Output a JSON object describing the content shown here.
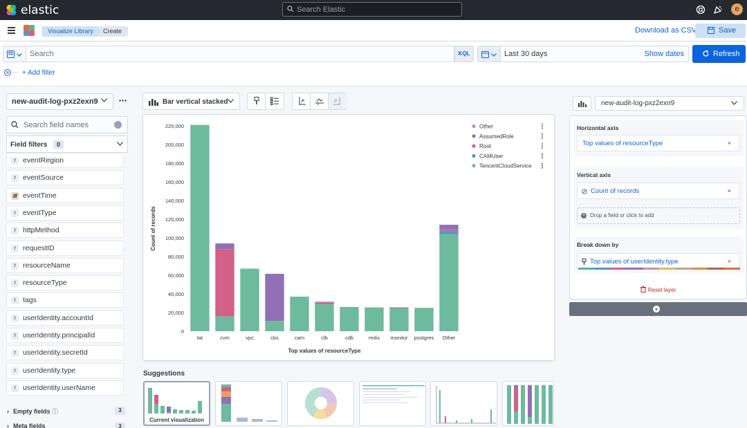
{
  "header": {
    "brand": "elastic",
    "search_placeholder": "Search Elastic",
    "avatar_initial": "e"
  },
  "subbar": {
    "breadcrumbs": [
      "Visualize Library",
      "Create"
    ],
    "download_label": "Download as CSV",
    "save_label": "Save"
  },
  "query": {
    "placeholder": "Search",
    "language": "KQL",
    "date_range": "Last 30 days",
    "show_dates_label": "Show dates",
    "refresh_label": "Refresh",
    "add_filter_label": "+ Add filter"
  },
  "left": {
    "index_pattern": "new-audit-log-pxz2exn9",
    "field_search_placeholder": "Search field names",
    "field_filters_label": "Field filters",
    "field_filters_count": "0",
    "fields": [
      {
        "name": "eventRegion",
        "type": "t"
      },
      {
        "name": "eventSource",
        "type": "t"
      },
      {
        "name": "eventTime",
        "type": "date"
      },
      {
        "name": "eventType",
        "type": "t"
      },
      {
        "name": "httpMethod",
        "type": "t"
      },
      {
        "name": "requestID",
        "type": "t"
      },
      {
        "name": "resourceName",
        "type": "t"
      },
      {
        "name": "resourceType",
        "type": "t"
      },
      {
        "name": "tags",
        "type": "t"
      },
      {
        "name": "userIdentity.accountId",
        "type": "t"
      },
      {
        "name": "userIdentity.principalId",
        "type": "t"
      },
      {
        "name": "userIdentity.secretId",
        "type": "t"
      },
      {
        "name": "userIdentity.type",
        "type": "t"
      },
      {
        "name": "userIdentity.userName",
        "type": "t"
      }
    ],
    "empty_fields_label": "Empty fields",
    "empty_fields_count": "3",
    "meta_fields_label": "Meta fields",
    "meta_fields_count": "3"
  },
  "toolbar": {
    "chart_type": "Bar vertical stacked"
  },
  "chart_data": {
    "type": "bar",
    "stacked": true,
    "categories": [
      "tat",
      "cvm",
      "vpc",
      "cbs",
      "cam",
      "clb",
      "cdb",
      "redis",
      "monitor",
      "postgres",
      "Other"
    ],
    "series": [
      {
        "name": "TencentCloudService",
        "color": "#6dba9e",
        "values": [
          221000,
          16000,
          67000,
          11000,
          37000,
          29000,
          26000,
          25500,
          24500,
          25000,
          104000
        ]
      },
      {
        "name": "CAMUser",
        "color": "#6092c0",
        "values": [
          0,
          0,
          0,
          0,
          0,
          0,
          0,
          0,
          0,
          0,
          4000
        ]
      },
      {
        "name": "Root",
        "color": "#d36086",
        "values": [
          0,
          72000,
          0,
          0,
          0,
          1500,
          0,
          0,
          0,
          0,
          1500
        ]
      },
      {
        "name": "AssumedRole",
        "color": "#9170b8",
        "values": [
          0,
          6000,
          0,
          50500,
          0,
          1000,
          0,
          0,
          1000,
          0,
          4500
        ]
      },
      {
        "name": "Other",
        "color": "#ca8eae",
        "values": [
          0,
          0,
          0,
          0,
          0,
          0,
          0,
          0,
          0,
          0,
          0
        ]
      }
    ],
    "legend_order": [
      "Other",
      "AssumedRole",
      "Root",
      "CAMUser",
      "TencentCloudService"
    ],
    "legend_position": "top-right",
    "xlabel": "Top values of resourceType",
    "ylabel": "Count of records",
    "ylim": [
      0,
      220000
    ],
    "yticks": [
      0,
      20000,
      40000,
      60000,
      80000,
      100000,
      120000,
      140000,
      160000,
      180000,
      200000,
      220000
    ],
    "ytick_labels": [
      "0",
      "20,000",
      "40,000",
      "60,000",
      "80,000",
      "100,000",
      "120,000",
      "140,000",
      "160,000",
      "180,000",
      "200,000",
      "220,000"
    ]
  },
  "suggestions": {
    "title": "Suggestions",
    "current_label": "Current visualization"
  },
  "config": {
    "index_pattern": "new-audit-log-pxz2exn9",
    "horizontal_axis_label": "Horizontal axis",
    "horizontal_value": "Top values of resourceType",
    "vertical_axis_label": "Vertical axis",
    "vertical_value": "Count of records",
    "drop_label": "Drop a field or click to add",
    "breakdown_label": "Break down by",
    "breakdown_value": "Top values of userIdentity.type",
    "reset_label": "Reset layer",
    "remove_symbol": "×"
  },
  "colors": {
    "accent": "#0b64dd",
    "header_bg": "#25282f",
    "danger": "#bd271e"
  }
}
